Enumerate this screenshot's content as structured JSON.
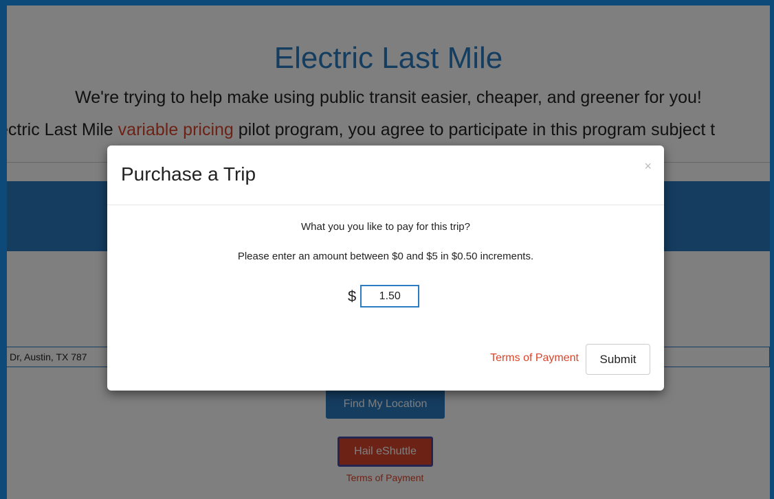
{
  "page": {
    "title": "Electric Last Mile",
    "tagline": "We're trying to help make using public transit easier, cheaper, and greener for you!",
    "pilot_text_before": "ectric Last Mile ",
    "pilot_link": "variable pricing",
    "pilot_text_after": " pilot program, you agree to participate in this program subject t",
    "address_value": "Dr, Austin, TX 787",
    "find_location_label": "Find My Location",
    "hail_label": "Hail eShuttle",
    "terms_label": "Terms of Payment"
  },
  "modal": {
    "title": "Purchase a Trip",
    "close_label": "×",
    "question": "What you you like to pay for this trip?",
    "instructions": "Please enter an amount between $0 and $5 in $0.50 increments.",
    "currency": "$",
    "amount_value": "1.50",
    "terms_label": "Terms of Payment",
    "submit_label": "Submit"
  },
  "colors": {
    "brand_blue": "#2a7bc1",
    "accent_red": "#d9442a",
    "outer_frame": "#0e4a79"
  }
}
